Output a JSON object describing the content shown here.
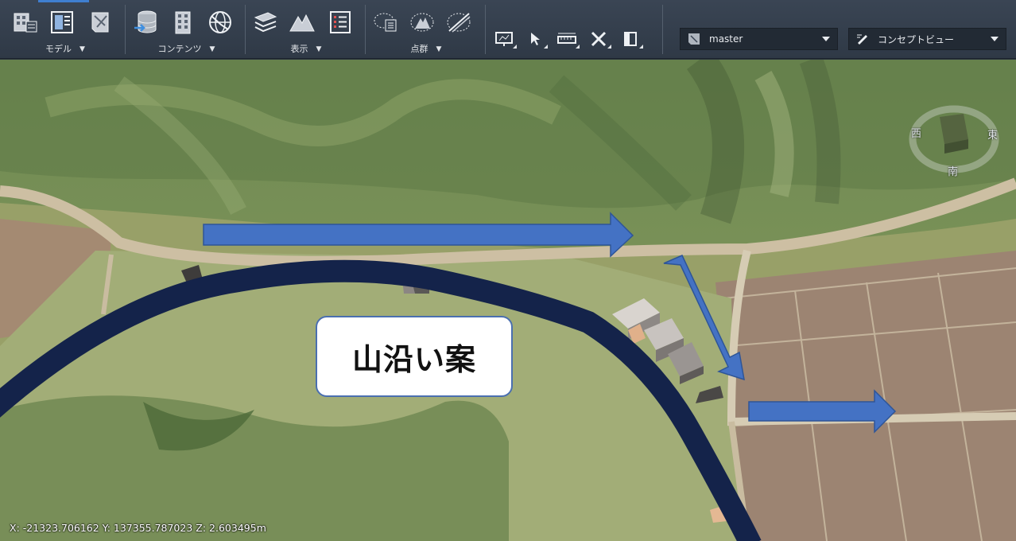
{
  "toolbar": {
    "groups": [
      {
        "label": "モデル"
      },
      {
        "label": "コンテンツ"
      },
      {
        "label": "表示"
      },
      {
        "label": "点群"
      }
    ],
    "branch_dropdown": {
      "value": "master"
    },
    "view_dropdown": {
      "value": "コンセプトビュー"
    }
  },
  "viewport": {
    "callout_text": "山沿い案",
    "arrow_color": "#4472c4",
    "road_color": "#14234a",
    "compass": {
      "north_hidden": "",
      "south": "南",
      "east": "東",
      "west": "西"
    },
    "coords": {
      "x": "X: -21323.706162",
      "y": "Y: 137355.787023",
      "z": "Z: 2.603495m"
    }
  },
  "icons": {
    "model": [
      "building-grid-icon",
      "model-panel-icon",
      "map-sheet-icon"
    ],
    "contents": [
      "database-import-icon",
      "building-icon",
      "globe-icon"
    ],
    "view": [
      "layers-icon",
      "terrain-icon",
      "list-panel-icon"
    ],
    "pointcloud": [
      "pointcloud-list-icon",
      "pointcloud-terrain-icon",
      "pointcloud-line-icon"
    ],
    "mini": [
      "screen-icon",
      "cursor-icon",
      "measure-icon",
      "tools-icon",
      "section-icon"
    ]
  }
}
